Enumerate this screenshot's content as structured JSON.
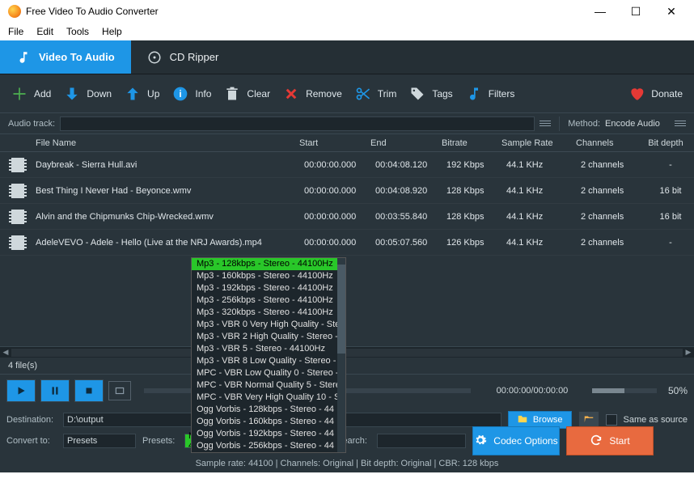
{
  "window": {
    "title": "Free Video To Audio Converter"
  },
  "menu": [
    "File",
    "Edit",
    "Tools",
    "Help"
  ],
  "tabs": {
    "video": "Video To Audio",
    "cd": "CD Ripper"
  },
  "toolbar": {
    "add": "Add",
    "down": "Down",
    "up": "Up",
    "info": "Info",
    "clear": "Clear",
    "remove": "Remove",
    "trim": "Trim",
    "tags": "Tags",
    "filters": "Filters",
    "donate": "Donate"
  },
  "row2": {
    "audiotrack": "Audio track:",
    "method": "Method:",
    "method_value": "Encode Audio"
  },
  "columns": {
    "name": "File Name",
    "start": "Start",
    "end": "End",
    "bitrate": "Bitrate",
    "sr": "Sample Rate",
    "ch": "Channels",
    "bd": "Bit depth"
  },
  "files": [
    {
      "name": "Daybreak - Sierra Hull.avi",
      "start": "00:00:00.000",
      "end": "00:04:08.120",
      "bitrate": "192 Kbps",
      "sr": "44.1 KHz",
      "ch": "2 channels",
      "bd": "-"
    },
    {
      "name": "Best Thing I Never Had - Beyonce.wmv",
      "start": "00:00:00.000",
      "end": "00:04:08.920",
      "bitrate": "128 Kbps",
      "sr": "44.1 KHz",
      "ch": "2 channels",
      "bd": "16 bit"
    },
    {
      "name": "Alvin and the Chipmunks Chip-Wrecked.wmv",
      "start": "00:00:00.000",
      "end": "00:03:55.840",
      "bitrate": "128 Kbps",
      "sr": "44.1 KHz",
      "ch": "2 channels",
      "bd": "16 bit"
    },
    {
      "name": "AdeleVEVO - Adele - Hello (Live at the NRJ Awards).mp4",
      "start": "00:00:00.000",
      "end": "00:05:07.560",
      "bitrate": "126 Kbps",
      "sr": "44.1 KHz",
      "ch": "2 channels",
      "bd": "-"
    }
  ],
  "dropdown_options": [
    "Mp3 - 128kbps - Stereo - 44100Hz",
    "Mp3 - 160kbps - Stereo - 44100Hz",
    "Mp3 - 192kbps - Stereo - 44100Hz",
    "Mp3 - 256kbps - Stereo - 44100Hz",
    "Mp3 - 320kbps - Stereo - 44100Hz",
    "Mp3 - VBR 0 Very High Quality - Ste",
    "Mp3 - VBR 2 High Quality - Stereo -",
    "Mp3 - VBR 5 - Stereo - 44100Hz",
    "Mp3 - VBR 8 Low Quality - Stereo - ",
    "MPC - VBR Low Quality 0 - Stereo - ",
    "MPC - VBR Normal Quality 5 - Stere",
    "MPC - VBR Very High Quality 10 - St",
    "Ogg Vorbis - 128kbps - Stereo - 44",
    "Ogg Vorbis - 160kbps - Stereo - 44",
    "Ogg Vorbis - 192kbps - Stereo - 44",
    "Ogg Vorbis - 256kbps - Stereo - 44"
  ],
  "status": {
    "count": "4 file(s)"
  },
  "player": {
    "time": "00:00:00/00:00:00",
    "vol": "50%"
  },
  "dest": {
    "label": "Destination:",
    "value": "D:\\output",
    "browse": "Browse",
    "same": "Same as source"
  },
  "convert": {
    "label": "Convert to:",
    "value": "Presets",
    "presets_label": "Presets:",
    "preset_value": "Mp3 - 128kbps - Stereo - 44100Hz",
    "search": "Search:",
    "codec": "Codec Options",
    "start": "Start"
  },
  "footer": "Sample rate: 44100 | Channels: Original | Bit depth: Original | CBR: 128 kbps"
}
